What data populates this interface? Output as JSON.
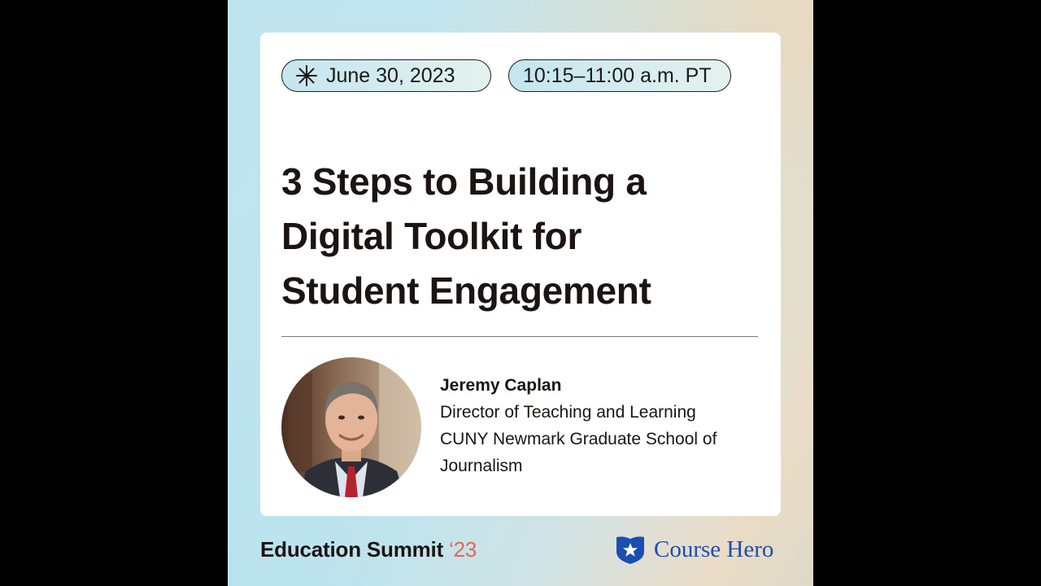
{
  "event": {
    "date": "June 30, 2023",
    "time": "10:15–11:00 a.m. PT"
  },
  "session": {
    "title_lines": [
      "3 Steps to Building a",
      "Digital Toolkit for",
      "Student Engagement"
    ]
  },
  "speaker": {
    "name": "Jeremy Caplan",
    "role": "Director of Teaching and Learning",
    "org_line1": "CUNY Newmark Graduate School of",
    "org_line2": "Journalism"
  },
  "footer": {
    "summit_name": "Education Summit",
    "summit_year": "‘23",
    "brand_name": "Course Hero"
  },
  "icons": {
    "date_icon": "asterisk-icon",
    "brand_logo": "shield-star-icon",
    "speaker_photo": "avatar"
  },
  "colors": {
    "accent_year": "#e0655a",
    "brand_blue": "#1a4fb0",
    "title_text": "#1c1414"
  }
}
